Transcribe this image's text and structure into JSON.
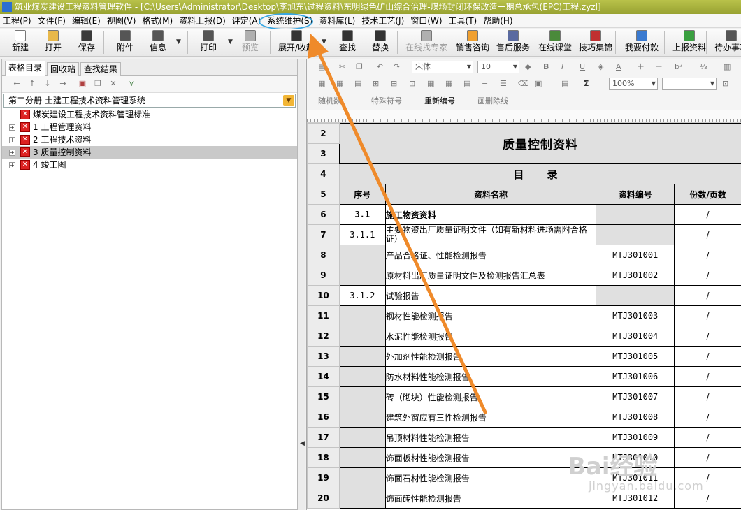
{
  "window": {
    "title": "筑业煤炭建设工程资料管理软件 - [C:\\Users\\Administrator\\Desktop\\李旭东\\过程资料\\东明绿色矿山综合治理-煤场封闭环保改造一期总承包(EPC)工程.zyzl]"
  },
  "menu": [
    {
      "label": "工程(P)"
    },
    {
      "label": "文件(F)"
    },
    {
      "label": "编辑(E)"
    },
    {
      "label": "视图(V)"
    },
    {
      "label": "格式(M)"
    },
    {
      "label": "资料上报(D)"
    },
    {
      "label": "评定(A)"
    },
    {
      "label": "系统维护(S)"
    },
    {
      "label": "资料库(L)"
    },
    {
      "label": "技术工艺(J)"
    },
    {
      "label": "窗口(W)"
    },
    {
      "label": "工具(T)"
    },
    {
      "label": "帮助(H)"
    }
  ],
  "toolbar": [
    {
      "label": "新建",
      "icon": "new-file-icon",
      "color": "#ffffff"
    },
    {
      "label": "打开",
      "icon": "open-folder-icon",
      "color": "#e8b84a"
    },
    {
      "label": "保存",
      "icon": "save-disk-icon",
      "color": "#3a3a3a"
    },
    {
      "label": "附件",
      "icon": "attachment-icon",
      "color": "#555555"
    },
    {
      "label": "信息",
      "icon": "info-icon",
      "color": "#555555"
    },
    {
      "label": "打印",
      "icon": "printer-icon",
      "color": "#555555"
    },
    {
      "label": "预览",
      "icon": "preview-icon",
      "color": "#b0b0b0",
      "disabled": true
    },
    {
      "label": "展开/收起",
      "icon": "expand-icon",
      "color": "#333333"
    },
    {
      "label": "查找",
      "icon": "binoculars-icon",
      "color": "#333333"
    },
    {
      "label": "替换",
      "icon": "replace-icon",
      "color": "#333333"
    },
    {
      "label": "在线找专家",
      "icon": "expert-icon",
      "color": "#b0b0b0",
      "disabled": true
    },
    {
      "label": "销售咨询",
      "icon": "sales-person-icon",
      "color": "#f0a030"
    },
    {
      "label": "售后服务",
      "icon": "service-person-icon",
      "color": "#5a6aa0"
    },
    {
      "label": "在线课堂",
      "icon": "classroom-icon",
      "color": "#4a8a3a"
    },
    {
      "label": "技巧集锦",
      "icon": "tips-book-icon",
      "color": "#c03030"
    },
    {
      "label": "我要付款",
      "icon": "payment-shield-icon",
      "color": "#3a7ad0"
    },
    {
      "label": "上报资料",
      "icon": "upload-icon",
      "color": "#3aa040"
    },
    {
      "label": "待办事项",
      "icon": "todo-icon",
      "color": "#555555"
    }
  ],
  "left_panel": {
    "tabs": [
      {
        "label": "表格目录",
        "active": true
      },
      {
        "label": "回收站"
      },
      {
        "label": "查找结果"
      }
    ],
    "volume_select": "第二分册 土建工程技术资料管理系统",
    "tree": [
      {
        "label": "煤炭建设工程技术资料管理标准",
        "expandable": false
      },
      {
        "label": "1 工程管理资料",
        "expandable": true
      },
      {
        "label": "2 工程技术资料",
        "expandable": true
      },
      {
        "label": "3 质量控制资料",
        "expandable": true,
        "selected": true
      },
      {
        "label": "4 竣工图",
        "expandable": true
      }
    ]
  },
  "format_bar": {
    "font": "宋体",
    "size": "10",
    "zoom": "100%",
    "row3": [
      "随机数",
      "特殊符号",
      "重新编号",
      "画删除线"
    ]
  },
  "sheet": {
    "title": "质量控制资料",
    "subtitle": "目 录",
    "headers": [
      "序号",
      "资料名称",
      "资料编号",
      "份数/页数"
    ],
    "row_numbers": [
      "2",
      "3",
      "4",
      "5",
      "6",
      "7",
      "8",
      "9",
      "10",
      "11",
      "12",
      "13",
      "14",
      "15",
      "16",
      "17",
      "18",
      "19",
      "20"
    ],
    "rows": [
      {
        "no": "3.1",
        "name": "施工物资资料",
        "code": "",
        "count": "/",
        "bold": true
      },
      {
        "no": "3.1.1",
        "name": "主要物资出厂质量证明文件（如有新材料进场需附合格证）",
        "code": "",
        "count": "/"
      },
      {
        "no": "",
        "name": "产品合格证、性能检测报告",
        "code": "MTJ301001",
        "count": "/"
      },
      {
        "no": "",
        "name": "原材料出厂质量证明文件及检测报告汇总表",
        "code": "MTJ301002",
        "count": "/"
      },
      {
        "no": "3.1.2",
        "name": "试验报告",
        "code": "",
        "count": "/"
      },
      {
        "no": "",
        "name": "钢材性能检测报告",
        "code": "MTJ301003",
        "count": "/"
      },
      {
        "no": "",
        "name": "水泥性能检测报告",
        "code": "MTJ301004",
        "count": "/"
      },
      {
        "no": "",
        "name": "外加剂性能检测报告",
        "code": "MTJ301005",
        "count": "/"
      },
      {
        "no": "",
        "name": "防水材料性能检测报告",
        "code": "MTJ301006",
        "count": "/"
      },
      {
        "no": "",
        "name": "砖（砌块）性能检测报告",
        "code": "MTJ301007",
        "count": "/"
      },
      {
        "no": "",
        "name": "建筑外窗应有三性检测报告",
        "code": "MTJ301008",
        "count": "/"
      },
      {
        "no": "",
        "name": "吊顶材料性能检测报告",
        "code": "MTJ301009",
        "count": "/"
      },
      {
        "no": "",
        "name": "饰面板材性能检测报告",
        "code": "MTJ301010",
        "count": "/"
      },
      {
        "no": "",
        "name": "饰面石材性能检测报告",
        "code": "MTJ301011",
        "count": "/"
      },
      {
        "no": "",
        "name": "饰面砖性能检测报告",
        "code": "MTJ301012",
        "count": "/"
      }
    ]
  },
  "watermark": {
    "main": "Bai经验",
    "sub": "jingyan.baidu.com"
  },
  "colors": {
    "title_bar": "#a7b13c",
    "highlight": "#37a7e3",
    "annotation_arrow": "#ef8a2a",
    "tree_mark": "#d22222"
  }
}
